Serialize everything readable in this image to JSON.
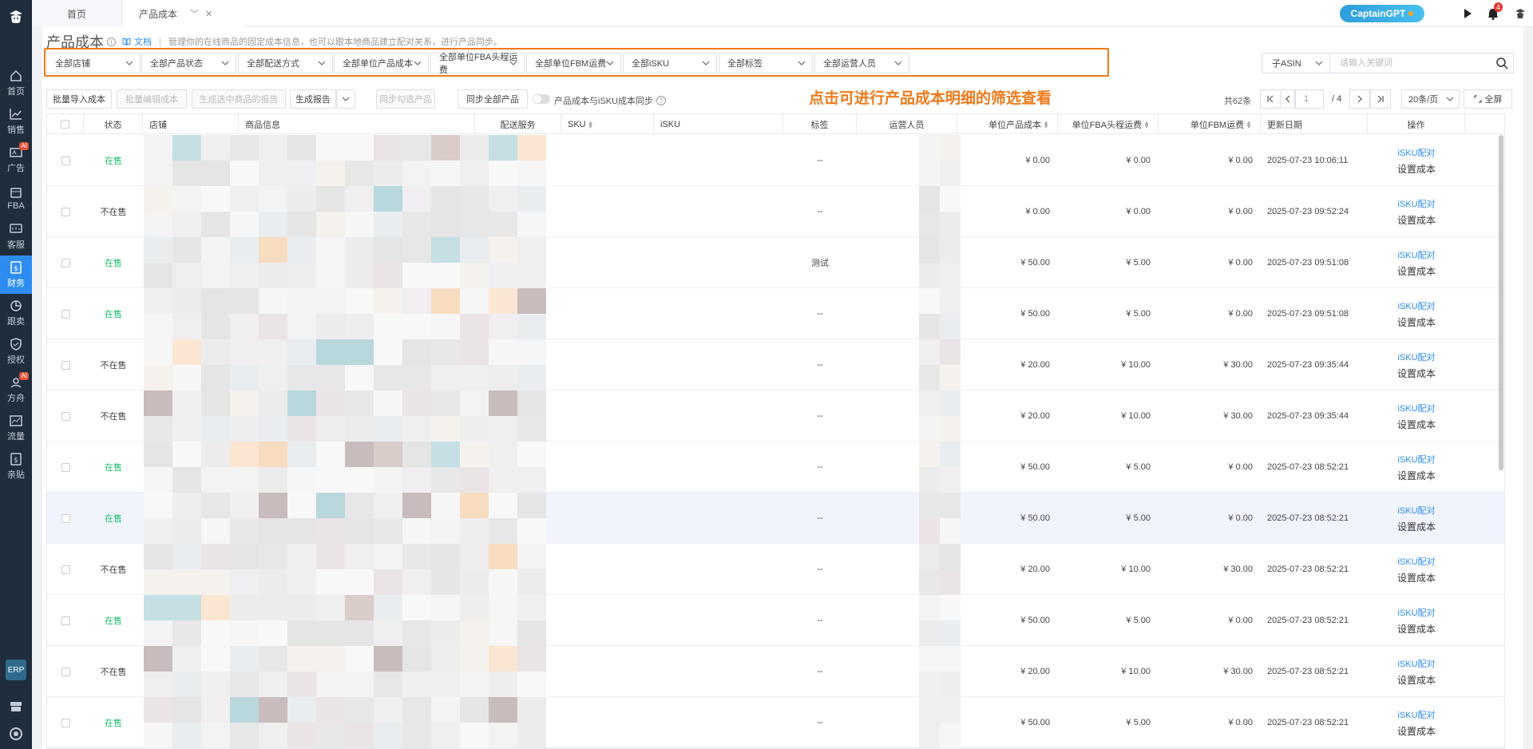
{
  "sidebar": {
    "items": [
      {
        "label": "首页",
        "icon": "home-icon",
        "ai": false,
        "active": false
      },
      {
        "label": "销售",
        "icon": "chart-line-icon",
        "ai": false,
        "active": false
      },
      {
        "label": "广告",
        "icon": "ad-icon",
        "ai": true,
        "active": false
      },
      {
        "label": "FBA",
        "icon": "box-icon",
        "ai": false,
        "active": false
      },
      {
        "label": "客服",
        "icon": "chat-icon",
        "ai": false,
        "active": false
      },
      {
        "label": "财务",
        "icon": "dollar-icon",
        "ai": false,
        "active": true
      },
      {
        "label": "跟卖",
        "icon": "pie-icon",
        "ai": false,
        "active": false
      },
      {
        "label": "授权",
        "icon": "shield-icon",
        "ai": false,
        "active": false
      },
      {
        "label": "方舟",
        "icon": "ark-icon",
        "ai": true,
        "active": false
      },
      {
        "label": "流量",
        "icon": "traffic-icon",
        "ai": false,
        "active": false
      },
      {
        "label": "亲贴",
        "icon": "dollar-doc-icon",
        "ai": false,
        "active": false
      }
    ],
    "ai_badge": "AI",
    "erp": "ERP"
  },
  "tabs": {
    "home": "首页",
    "cost": "产品成本"
  },
  "header": {
    "captain": "CaptainGPT",
    "bell_count": "4"
  },
  "page": {
    "title": "产品成本",
    "doc": "文档",
    "desc": "管理你的在线商品的固定成本信息，也可以跟本地商品建立配对关系，进行产品同步。"
  },
  "filters": [
    "全部店铺",
    "全部产品状态",
    "全部配送方式",
    "全部单位产品成本",
    "全部单位FBA头程运费",
    "全部单位FBM运费",
    "全部iSKU",
    "全部标签",
    "全部运营人员"
  ],
  "search": {
    "type": "子ASIN",
    "placeholder": "请输入关键词"
  },
  "toolbar": {
    "import": "批量导入成本",
    "batch_edit": "批量编辑成本",
    "gen_selected": "生成选中商品的报告",
    "gen_report": "生成报告",
    "sync_selected": "同步勾选产品",
    "sync_all": "同步全部产品",
    "toggle_label": "产品成本与iSKU成本同步"
  },
  "annotation": "点击可进行产品成本明细的筛选查看",
  "pagination": {
    "total": "共62条",
    "current": "1",
    "of": "/ 4",
    "per_page": "20条/页",
    "fullscreen": "全屏"
  },
  "columns": {
    "status": "状态",
    "store": "店铺",
    "product": "商品信息",
    "shipping": "配送服务",
    "sku": "SKU",
    "isku": "iSKU",
    "tag": "标签",
    "operator": "运营人员",
    "unit_cost": "单位产品成本",
    "fba_freight": "单位FBA头程运费",
    "fbm_freight": "单位FBM运费",
    "updated": "更新日期",
    "ops": "操作"
  },
  "ops": {
    "pair": "iSKU配对",
    "set_cost": "设置成本"
  },
  "rows": [
    {
      "status": "在售",
      "on": true,
      "tag": "--",
      "unit_cost": "¥ 0.00",
      "fba": "¥ 0.00",
      "fbm": "¥ 0.00",
      "updated": "2025-07-23 10:06:11"
    },
    {
      "status": "不在售",
      "on": false,
      "tag": "--",
      "unit_cost": "¥ 0.00",
      "fba": "¥ 0.00",
      "fbm": "¥ 0.00",
      "updated": "2025-07-23 09:52:24"
    },
    {
      "status": "在售",
      "on": true,
      "tag": "测试",
      "unit_cost": "¥ 50.00",
      "fba": "¥ 5.00",
      "fbm": "¥ 0.00",
      "updated": "2025-07-23 09:51:08"
    },
    {
      "status": "在售",
      "on": true,
      "tag": "--",
      "unit_cost": "¥ 50.00",
      "fba": "¥ 5.00",
      "fbm": "¥ 0.00",
      "updated": "2025-07-23 09:51:08"
    },
    {
      "status": "不在售",
      "on": false,
      "tag": "--",
      "unit_cost": "¥ 20.00",
      "fba": "¥ 10.00",
      "fbm": "¥ 30.00",
      "updated": "2025-07-23 09:35:44"
    },
    {
      "status": "不在售",
      "on": false,
      "tag": "--",
      "unit_cost": "¥ 20.00",
      "fba": "¥ 10.00",
      "fbm": "¥ 30.00",
      "updated": "2025-07-23 09:35:44"
    },
    {
      "status": "在售",
      "on": true,
      "tag": "--",
      "unit_cost": "¥ 50.00",
      "fba": "¥ 5.00",
      "fbm": "¥ 0.00",
      "updated": "2025-07-23 08:52:21"
    },
    {
      "status": "在售",
      "on": true,
      "tag": "--",
      "unit_cost": "¥ 50.00",
      "fba": "¥ 5.00",
      "fbm": "¥ 0.00",
      "updated": "2025-07-23 08:52:21"
    },
    {
      "status": "不在售",
      "on": false,
      "tag": "--",
      "unit_cost": "¥ 20.00",
      "fba": "¥ 10.00",
      "fbm": "¥ 30.00",
      "updated": "2025-07-23 08:52:21"
    },
    {
      "status": "在售",
      "on": true,
      "tag": "--",
      "unit_cost": "¥ 50.00",
      "fba": "¥ 5.00",
      "fbm": "¥ 0.00",
      "updated": "2025-07-23 08:52:21"
    },
    {
      "status": "不在售",
      "on": false,
      "tag": "--",
      "unit_cost": "¥ 20.00",
      "fba": "¥ 10.00",
      "fbm": "¥ 30.00",
      "updated": "2025-07-23 08:52:21"
    },
    {
      "status": "在售",
      "on": true,
      "tag": "--",
      "unit_cost": "¥ 50.00",
      "fba": "¥ 5.00",
      "fbm": "¥ 0.00",
      "updated": "2025-07-23 08:52:21"
    }
  ],
  "colors": {
    "accent": "#2d8cf0",
    "annotation": "#f07a1a",
    "on_sale": "#19be6b",
    "sidebar": "#1f2d3d"
  }
}
